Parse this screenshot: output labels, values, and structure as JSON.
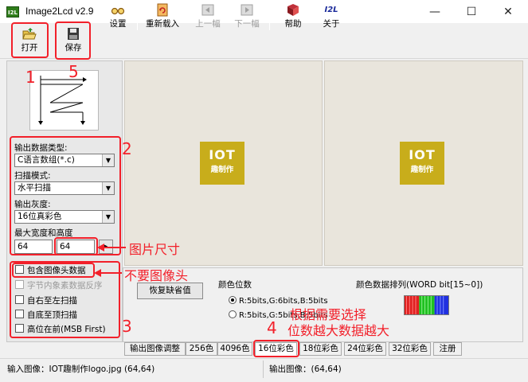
{
  "window": {
    "title": "Image2Lcd v2.9",
    "icon_text": "I2L",
    "minimize": "—",
    "maximize": "☐",
    "close": "✕"
  },
  "toolbar": [
    {
      "label": "打开",
      "icon": "folder-open-icon",
      "enabled": true
    },
    {
      "label": "保存",
      "icon": "floppy-disk-icon",
      "enabled": true
    },
    {
      "label": "设置",
      "icon": "glasses-icon",
      "enabled": true
    },
    {
      "label": "重新载入",
      "icon": "reload-icon",
      "enabled": true
    },
    {
      "label": "上一幅",
      "icon": "previous-image-icon",
      "enabled": false
    },
    {
      "label": "下一幅",
      "icon": "next-image-icon",
      "enabled": false
    },
    {
      "label": "帮助",
      "icon": "help-book-icon",
      "enabled": true
    },
    {
      "label": "关于",
      "icon": "i2l-logo-icon",
      "enabled": true
    }
  ],
  "toolbar_about_icon_text": "I2L",
  "options": {
    "output_type_label": "输出数据类型:",
    "output_type_value": "C语言数组(*.c)",
    "scan_mode_label": "扫描模式:",
    "scan_mode_value": "水平扫描",
    "gray_label": "输出灰度:",
    "gray_value": "16位真彩色",
    "max_size_label": "最大宽度和高度",
    "max_width": "64",
    "max_height": "64",
    "size_button": "▸"
  },
  "checkboxes": [
    {
      "label": "包含图像头数据",
      "checked": false,
      "enabled": true
    },
    {
      "label": "字节内象素数据反序",
      "checked": false,
      "enabled": false
    },
    {
      "label": "自右至左扫描",
      "checked": false,
      "enabled": true
    },
    {
      "label": "自底至顶扫描",
      "checked": false,
      "enabled": true
    },
    {
      "label": "高位在前(MSB First)",
      "checked": false,
      "enabled": true
    }
  ],
  "preview": {
    "logo_line1": "IOT",
    "logo_line2": "趣制作",
    "logo_color": "#c8ad1b"
  },
  "settings": {
    "restore_button": "恢复缺省值",
    "color_bits_label": "颜色位数",
    "radio1": "R:5bits,G:6bits,B:5bits",
    "radio2": "R:5bits,G:5bits,B:5bits",
    "color_order_label": "颜色数据排列(WORD bit[15~0])"
  },
  "tabs": [
    "输出图像调整",
    "256色",
    "4096色",
    "16位彩色",
    "18位彩色",
    "24位彩色",
    "32位彩色",
    "注册"
  ],
  "active_tab": "16位彩色",
  "status": {
    "input": "输入图像：IOT趣制作logo.jpg (64,64)",
    "output": "输出图像：(64,64)"
  },
  "annotations": {
    "n1": "1",
    "n2": "2",
    "n3": "3",
    "n4": "4",
    "n5": "5",
    "img_size": "图片尺寸",
    "no_header": "不要图像头",
    "choose_line1": "根据需要选择",
    "choose_line2": "位数越大数据越大",
    "color": "#f2202a"
  }
}
